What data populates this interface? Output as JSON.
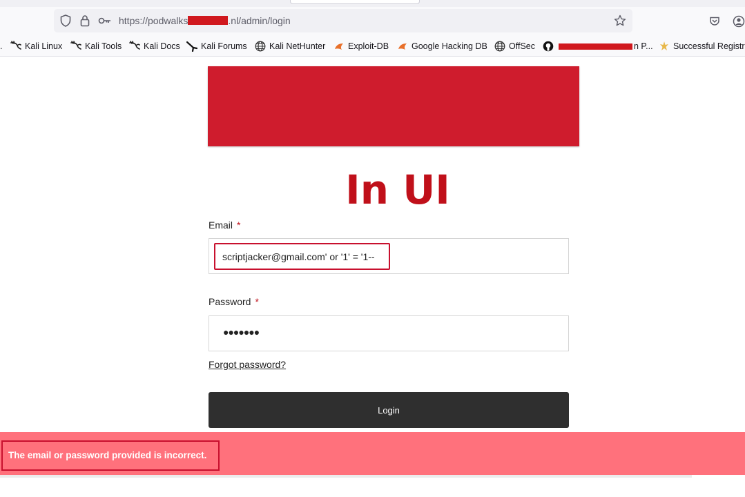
{
  "browser": {
    "url_prefix": "https://podwalks",
    "url_suffix": ".nl/admin/login"
  },
  "bookmarks": {
    "first_partial": ".",
    "kali_linux": "Kali Linux",
    "kali_tools": "Kali Tools",
    "kali_docs": "Kali Docs",
    "kali_forums": "Kali Forums",
    "kali_nethunter": "Kali NetHunter",
    "exploit_db": "Exploit-DB",
    "google_hacking_db": "Google Hacking DB",
    "offsec": "OffSec",
    "github_suffix": "n P...",
    "successful_registration": "Successful Registra"
  },
  "page": {
    "overlay_title": "In UI",
    "email_label": "Email",
    "required_mark": "*",
    "email_value": "scriptjacker@gmail.com' or '1' = '1--",
    "password_label": "Password",
    "password_mask": "●●●●●●●",
    "forgot_link": "Forgot password?",
    "login_button": "Login"
  },
  "toast": {
    "message": "The email or password provided is incorrect."
  },
  "colors": {
    "banner": "#cf1c2d",
    "overlay_title": "#c0101a",
    "annotation_box": "#c8102e",
    "toast_background": "#ff717c",
    "login_button": "#2f2f2f"
  }
}
